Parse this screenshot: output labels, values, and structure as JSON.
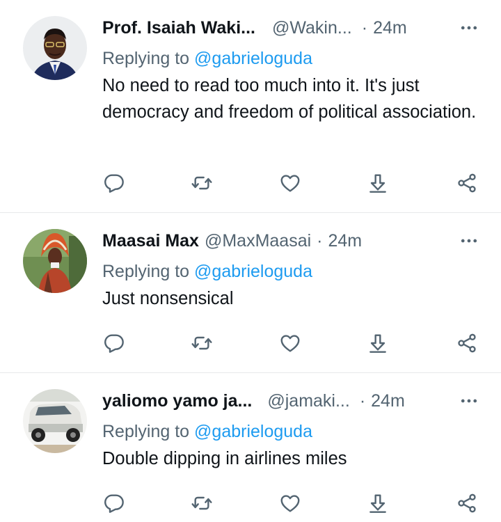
{
  "tweets": [
    {
      "name": "Prof. Isaiah Waki...",
      "handle": "@Wakin...",
      "time": "24m",
      "replying_prefix": "Replying to",
      "replying_to": "@gabrieloguda",
      "text": "No need to read too much into it. It's just democracy and freedom of political association."
    },
    {
      "name": "Maasai Max",
      "handle": "@MaxMaasai",
      "time": "24m",
      "replying_prefix": "Replying to",
      "replying_to": "@gabrieloguda",
      "text": "Just nonsensical"
    },
    {
      "name": "yaliomo yamo ja...",
      "handle": "@jamaki...",
      "time": "24m",
      "replying_prefix": "Replying to",
      "replying_to": "@gabrieloguda",
      "text": "Double dipping in airlines miles"
    }
  ],
  "separator": "·",
  "colors": {
    "text": "#0f1419",
    "secondary": "#536471",
    "link": "#1d9bf0",
    "divider": "#e7e9ea"
  },
  "icons": [
    "reply-icon",
    "retweet-icon",
    "like-icon",
    "download-icon",
    "share-icon",
    "more-icon"
  ]
}
